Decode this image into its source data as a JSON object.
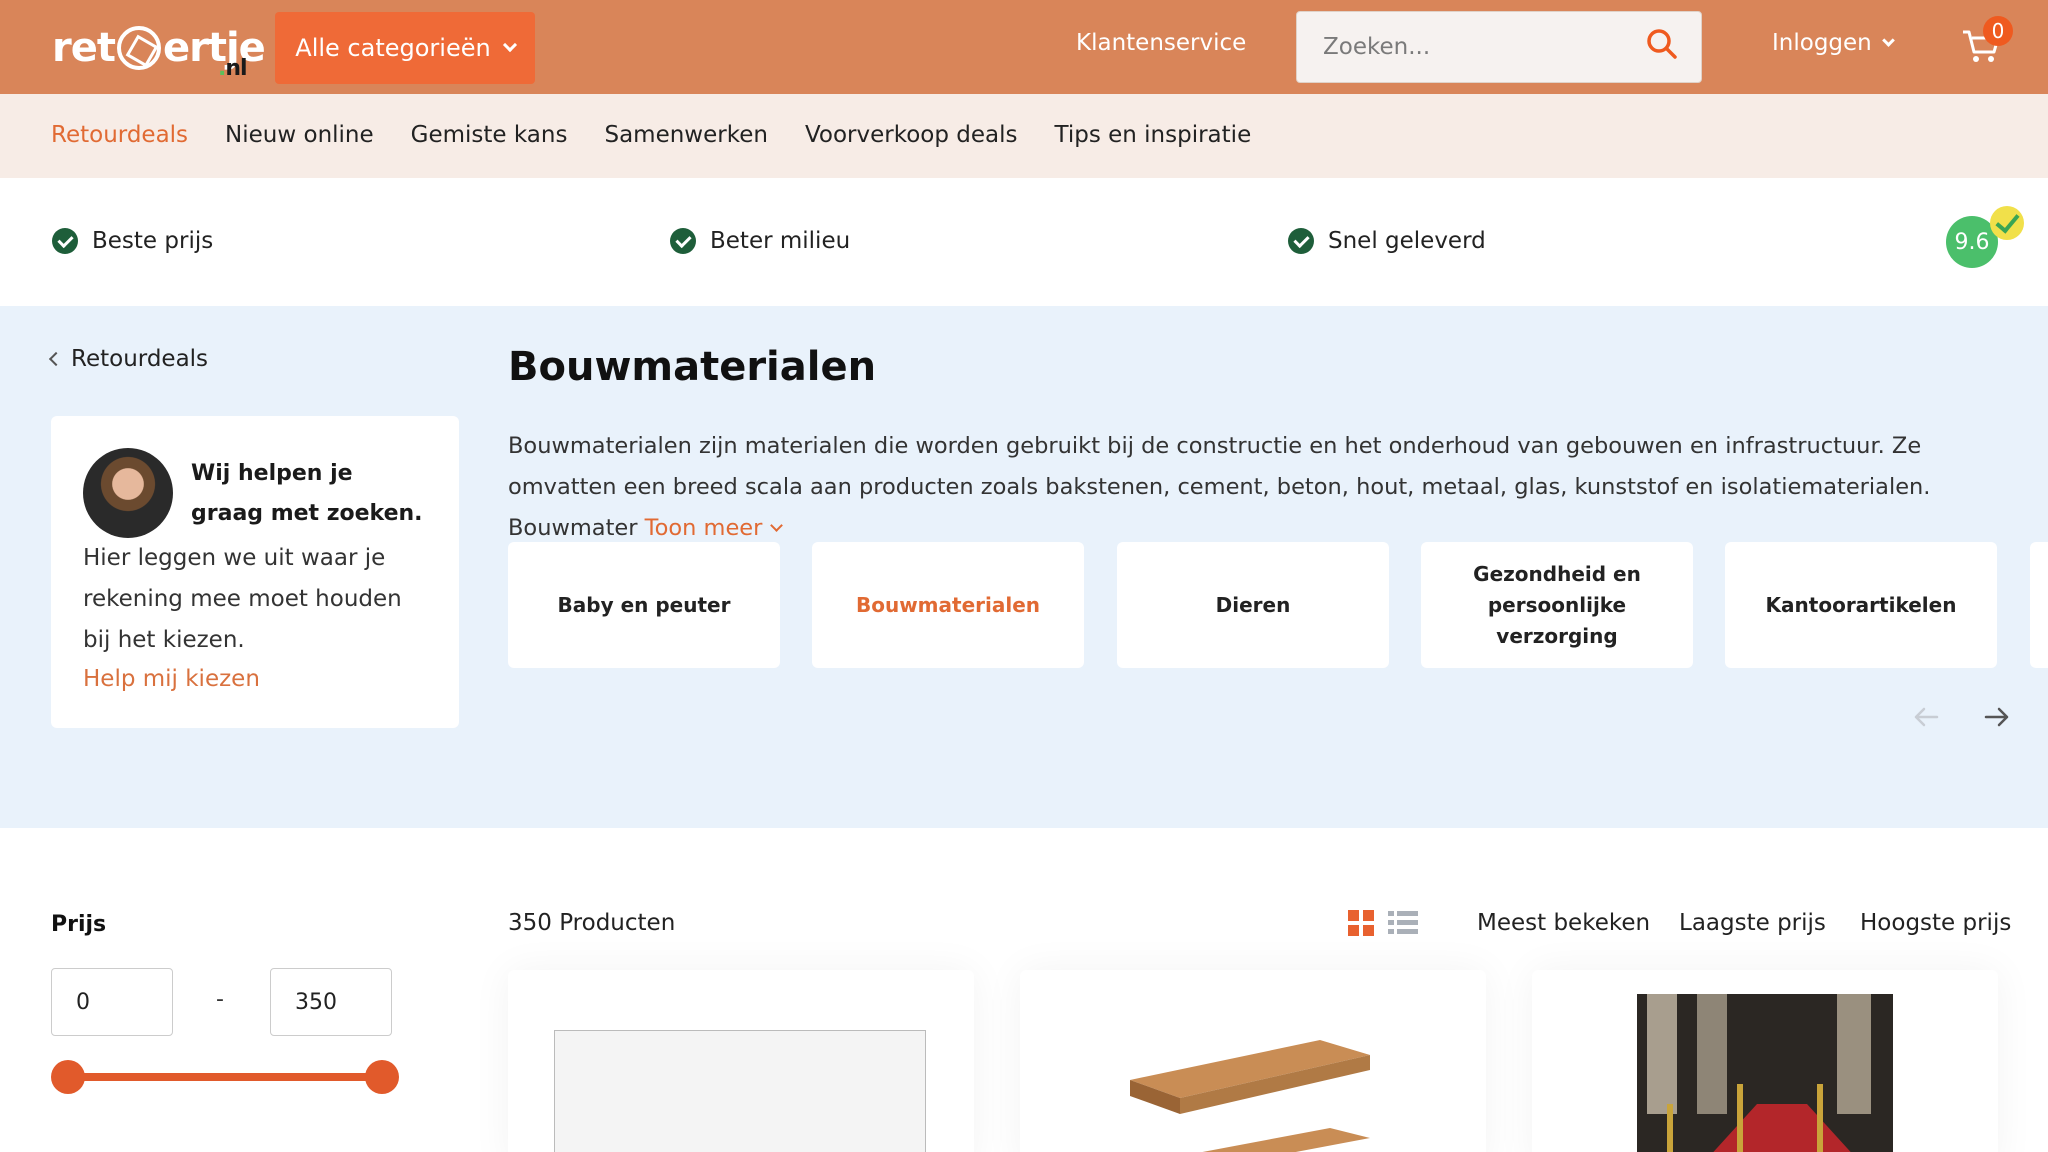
{
  "header": {
    "logo_text": "ret⟳ertje",
    "logo_suffix": ".nl",
    "categories_button": "Alle categorieën",
    "customer_service": "Klantenservice",
    "search_placeholder": "Zoeken...",
    "login": "Inloggen",
    "cart_count": "0",
    "accent_color": "#d98559",
    "button_color": "#ef6a37"
  },
  "subnav": {
    "items": [
      "Retourdeals",
      "Nieuw online",
      "Gemiste kans",
      "Samenwerken",
      "Voorverkoop deals",
      "Tips en inspiratie"
    ],
    "active_index": 0
  },
  "usp": {
    "items": [
      "Beste prijs",
      "Beter milieu",
      "Snel geleverd"
    ],
    "rating": "9.6"
  },
  "hero": {
    "back_label": "Retourdeals",
    "help_title": "Wij helpen je graag met zoeken.",
    "help_text": "Hier leggen we uit waar je rekening mee moet houden bij het kiezen.",
    "help_link": "Help mij kiezen",
    "title": "Bouwmaterialen",
    "description": "Bouwmaterialen zijn materialen die worden gebruikt bij de constructie en het onderhoud van gebouwen en infrastructuur. Ze omvatten een breed scala aan producten zoals bakstenen, cement, beton, hout, metaal, glas, kunststof en isolatiematerialen. Bouwmater",
    "more_label": "Toon meer",
    "categories": [
      "Baby en peuter",
      "Bouwmaterialen",
      "Dieren",
      "Gezondheid en persoonlijke verzorging",
      "Kantoorartikelen"
    ],
    "active_category": "Bouwmaterialen"
  },
  "filters": {
    "price_label": "Prijs",
    "price_min": "0",
    "price_max": "350",
    "separator": "-"
  },
  "listing": {
    "count": "350 Producten",
    "sort_options": [
      "Meest bekeken",
      "Laagste prijs",
      "Hoogste prijs"
    ]
  }
}
